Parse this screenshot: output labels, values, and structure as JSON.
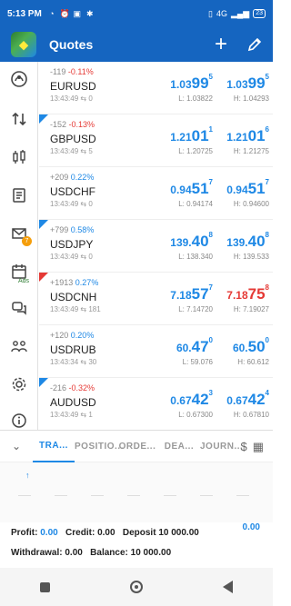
{
  "status_bar": {
    "time": "5:13 PM",
    "network": "4G",
    "battery": "23"
  },
  "app": {
    "title": "Quotes"
  },
  "sidebar": {
    "items": [
      {
        "icon": "quotes-icon"
      },
      {
        "icon": "trade-arrows-icon"
      },
      {
        "icon": "chart-candles-icon"
      },
      {
        "icon": "history-icon"
      },
      {
        "icon": "mail-icon",
        "badge": "7"
      },
      {
        "icon": "calendar-icon",
        "label": "Ads"
      },
      {
        "icon": "chat-icon"
      },
      {
        "icon": "community-icon"
      },
      {
        "icon": "settings-icon"
      },
      {
        "icon": "info-icon"
      }
    ]
  },
  "quotes": [
    {
      "symbol": "EURUSD",
      "points": "-119",
      "pct": "-0.11%",
      "trend": "neg",
      "time": "13:43:49",
      "spread": "0",
      "bid_main": "1.03",
      "bid_big": "99",
      "bid_sup": "5",
      "ask_main": "1.03",
      "ask_big": "99",
      "ask_sup": "5",
      "low": "L: 1.03822",
      "high": "H: 1.04293",
      "color": "blue",
      "corner": ""
    },
    {
      "symbol": "GBPUSD",
      "points": "-152",
      "pct": "-0.13%",
      "trend": "neg",
      "time": "13:43:49",
      "spread": "5",
      "bid_main": "1.21",
      "bid_big": "01",
      "bid_sup": "1",
      "ask_main": "1.21",
      "ask_big": "01",
      "ask_sup": "6",
      "low": "L: 1.20725",
      "high": "H: 1.21275",
      "color": "blue",
      "corner": "blue"
    },
    {
      "symbol": "USDCHF",
      "points": "+209",
      "pct": "0.22%",
      "trend": "pos",
      "time": "13:43:49",
      "spread": "0",
      "bid_main": "0.94",
      "bid_big": "51",
      "bid_sup": "7",
      "ask_main": "0.94",
      "ask_big": "51",
      "ask_sup": "7",
      "low": "L: 0.94174",
      "high": "H: 0.94600",
      "color": "blue",
      "corner": ""
    },
    {
      "symbol": "USDJPY",
      "points": "+799",
      "pct": "0.58%",
      "trend": "pos",
      "time": "13:43:49",
      "spread": "0",
      "bid_main": "139.",
      "bid_big": "40",
      "bid_sup": "8",
      "ask_main": "139.",
      "ask_big": "40",
      "ask_sup": "8",
      "low": "L: 138.340",
      "high": "H: 139.533",
      "color": "blue",
      "corner": "blue"
    },
    {
      "symbol": "USDCNH",
      "points": "+1913",
      "pct": "0.27%",
      "trend": "pos",
      "time": "13:43:49",
      "spread": "181",
      "bid_main": "7.18",
      "bid_big": "57",
      "bid_sup": "7",
      "ask_main": "7.18",
      "ask_big": "75",
      "ask_sup": "8",
      "low": "L: 7.14720",
      "high": "H: 7.19027",
      "color": "blue",
      "ask_color": "red",
      "corner": "red"
    },
    {
      "symbol": "USDRUB",
      "points": "+120",
      "pct": "0.20%",
      "trend": "pos",
      "time": "13:43:34",
      "spread": "30",
      "bid_main": "60.",
      "bid_big": "47",
      "bid_sup": "0",
      "ask_main": "60.",
      "ask_big": "50",
      "ask_sup": "0",
      "low": "L: 59.076",
      "high": "H: 60.612",
      "color": "blue",
      "corner": ""
    },
    {
      "symbol": "AUDUSD",
      "points": "-216",
      "pct": "-0.32%",
      "trend": "neg",
      "time": "13:43:49",
      "spread": "1",
      "bid_main": "0.67",
      "bid_big": "42",
      "bid_sup": "3",
      "ask_main": "0.67",
      "ask_big": "42",
      "ask_sup": "4",
      "low": "L: 0.67300",
      "high": "H: 0.67810",
      "color": "blue",
      "corner": "blue"
    }
  ],
  "tabs": [
    {
      "label": "TRA...",
      "active": true
    },
    {
      "label": "POSITIO...",
      "active": false
    },
    {
      "label": "ORDE...",
      "active": false
    },
    {
      "label": "DEA...",
      "active": false
    },
    {
      "label": "JOURN...",
      "active": false
    }
  ],
  "summary": {
    "profit_label": "Profit:",
    "profit_value": "0.00",
    "credit_label": "Credit:",
    "credit_value": "0.00",
    "deposit_label": "Deposit",
    "deposit_value": "10 000.00",
    "withdrawal_label": "Withdrawal:",
    "withdrawal_value": "0.00",
    "balance_label": "Balance:",
    "balance_value": "10 000.00",
    "total": "0.00"
  },
  "colors": {
    "primary": "#1565c0",
    "up": "#1e88e5",
    "down": "#e53935"
  }
}
